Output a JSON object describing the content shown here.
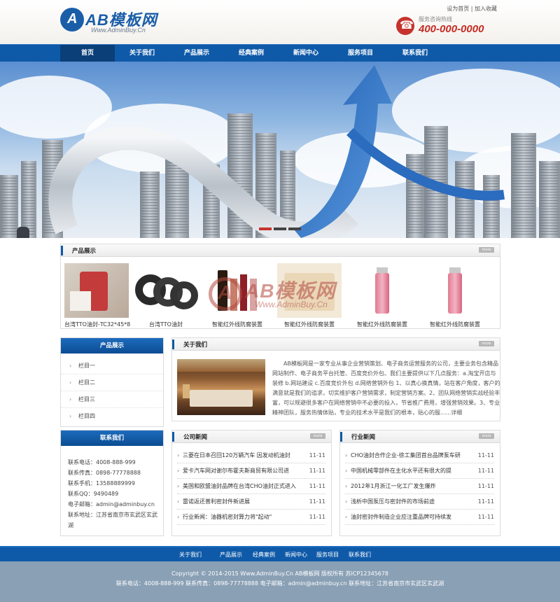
{
  "header": {
    "logo_main": "AB模板网",
    "logo_mark": "A",
    "logo_url": "Www.AdminBuy.Cn",
    "top_links": [
      "设为首页",
      "加入收藏"
    ],
    "top_sep": "|",
    "hotline_label": "服务咨询热线",
    "hotline_number": "400-000-0000"
  },
  "nav": {
    "items": [
      "首页",
      "关于我们",
      "产品展示",
      "经典案例",
      "新闻中心",
      "服务项目",
      "联系我们"
    ],
    "active": "首页"
  },
  "banner": {
    "slides": 3,
    "active_slide": 1
  },
  "products": {
    "title": "产品展示",
    "more": "more",
    "items": [
      "台湾TTO油封-TC32*45*8",
      "台湾TTO油封",
      "智能红外线防腐装置",
      "智能红外线防腐装置",
      "智能红外线防腐装置",
      "智能红外线防腐装置"
    ]
  },
  "watermark": {
    "mark": "A",
    "text": "AB模板网",
    "url": "Www.AdminBuy.Cn"
  },
  "sidebar": {
    "title": "产品展示",
    "items": [
      "栏目一",
      "栏目二",
      "栏目三",
      "栏目四"
    ]
  },
  "contact": {
    "title": "联系我们",
    "lines": [
      "联系电话：4008-888-999",
      "联系传真：0898-77778888",
      "联系手机：13588889999",
      "联系QQ：9490489",
      "电子邮箱：admin@adminbuy.cn",
      "联系地址：江苏省南京市玄武区玄武",
      "湖"
    ]
  },
  "about": {
    "title": "关于我们",
    "more": "more",
    "text": "AB模板网是一家专业从事企业营销策划、电子商务运营服务的公司，主要业务包含精品网站制作、电子商务平台托管、百度竞价外包、我们主要提供以下几点服务：a.淘宝开店与装修 b.网站建设 c.百度竞价外包 d.网络营销外包 1、以真心换真情，站在客户角度，客户的满意就是我们的追求，切实维护客户营销需求，制定营销方案。2、团队网络营销实战经验丰富，可以规避很多客户在网络营销中不必要的投入，节省推广费用，增强营销效果。3、专业精神团队，服务热情体贴，专业的技术水平是我们的根本，贴心的服......详细"
  },
  "company_news": {
    "title": "公司新闻",
    "more": "more",
    "rows": [
      {
        "title": "三菱在日本召回120万辆汽车 因发动机油封",
        "date": "11-11"
      },
      {
        "title": "爱卡汽车网对谢尔布霍夫斯商贸有限公司进",
        "date": "11-11"
      },
      {
        "title": "美国和欧盟油封品牌在台湾CHO油封正式进入",
        "date": "11-11"
      },
      {
        "title": "雷诺返还普利密封件新进展",
        "date": "11-11"
      },
      {
        "title": "行业新闻：油器机密封算力将\"起动\"",
        "date": "11-11"
      }
    ]
  },
  "industry_news": {
    "title": "行业新闻",
    "more": "more",
    "rows": [
      {
        "title": "CHO油封合作企业-徐工集团首台品牌泵车研",
        "date": "11-11"
      },
      {
        "title": "中国机械零部件在主化水平还有很大的提",
        "date": "11-11"
      },
      {
        "title": "2012年1月浙江一化工厂发生爆炸",
        "date": "11-11"
      },
      {
        "title": "浅析中国泵压与密封件的市场前途",
        "date": "11-11"
      },
      {
        "title": "油封密封件制造企业应注重品牌可持续发",
        "date": "11-11"
      }
    ]
  },
  "footer": {
    "links": [
      "关于我们",
      "产品展示",
      "经典案例",
      "新闻中心",
      "服务项目",
      "联系我们"
    ],
    "copyright": "Copyright © 2014-2015 Www.AdminBuy.Cn AB模板网  版权所有  苏ICP12345678",
    "contact": "联系电话：4008-888-999 联系传真：0898-77778888 电子邮箱：admin@adminbuy.cn 联系地址：江苏省南京市玄武区玄武湖"
  },
  "colors": {
    "primary": "#0f5aa8",
    "dark": "#0a3f78",
    "hotline": "#c52a22",
    "footer": "#8aa0b5"
  }
}
